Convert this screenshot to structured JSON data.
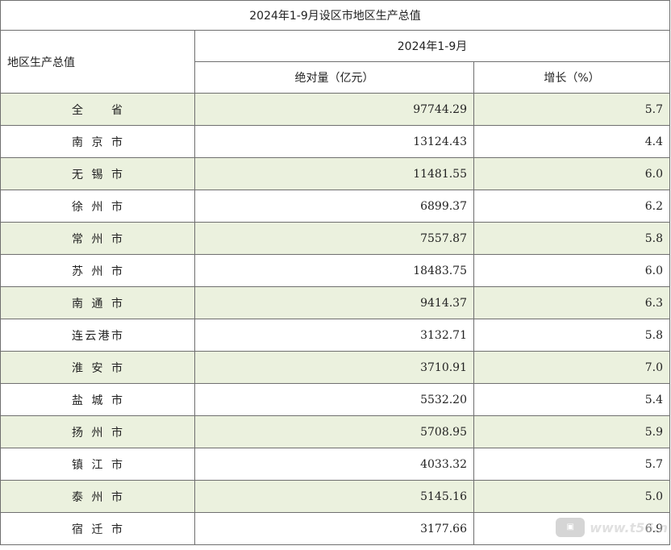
{
  "table": {
    "title": "2024年1-9月设区市地区生产总值",
    "row_header": "地区生产总值",
    "period": "2024年1-9月",
    "col_value": "绝对量（亿元）",
    "col_growth": "增长（%）",
    "rows": [
      {
        "region": "全省",
        "value": "97744.29",
        "growth": "5.7"
      },
      {
        "region": "南京市",
        "value": "13124.43",
        "growth": "4.4"
      },
      {
        "region": "无锡市",
        "value": "11481.55",
        "growth": "6.0"
      },
      {
        "region": "徐州市",
        "value": "6899.37",
        "growth": "6.2"
      },
      {
        "region": "常州市",
        "value": "7557.87",
        "growth": "5.8"
      },
      {
        "region": "苏州市",
        "value": "18483.75",
        "growth": "6.0"
      },
      {
        "region": "南通市",
        "value": "9414.37",
        "growth": "6.3"
      },
      {
        "region": "连云港市",
        "value": "3132.71",
        "growth": "5.8"
      },
      {
        "region": "淮安市",
        "value": "3710.91",
        "growth": "7.0"
      },
      {
        "region": "盐城市",
        "value": "5532.20",
        "growth": "5.4"
      },
      {
        "region": "扬州市",
        "value": "5708.95",
        "growth": "5.9"
      },
      {
        "region": "镇江市",
        "value": "4033.32",
        "growth": "5.7"
      },
      {
        "region": "泰州市",
        "value": "5145.16",
        "growth": "5.0"
      },
      {
        "region": "宿迁市",
        "value": "3177.66",
        "growth": "6.9"
      }
    ]
  },
  "colors": {
    "shaded_row": "#ebf1de",
    "border": "#6f6f6f"
  },
  "watermark": {
    "badge_icon": "site-logo-icon",
    "text": "www.t56.n"
  }
}
